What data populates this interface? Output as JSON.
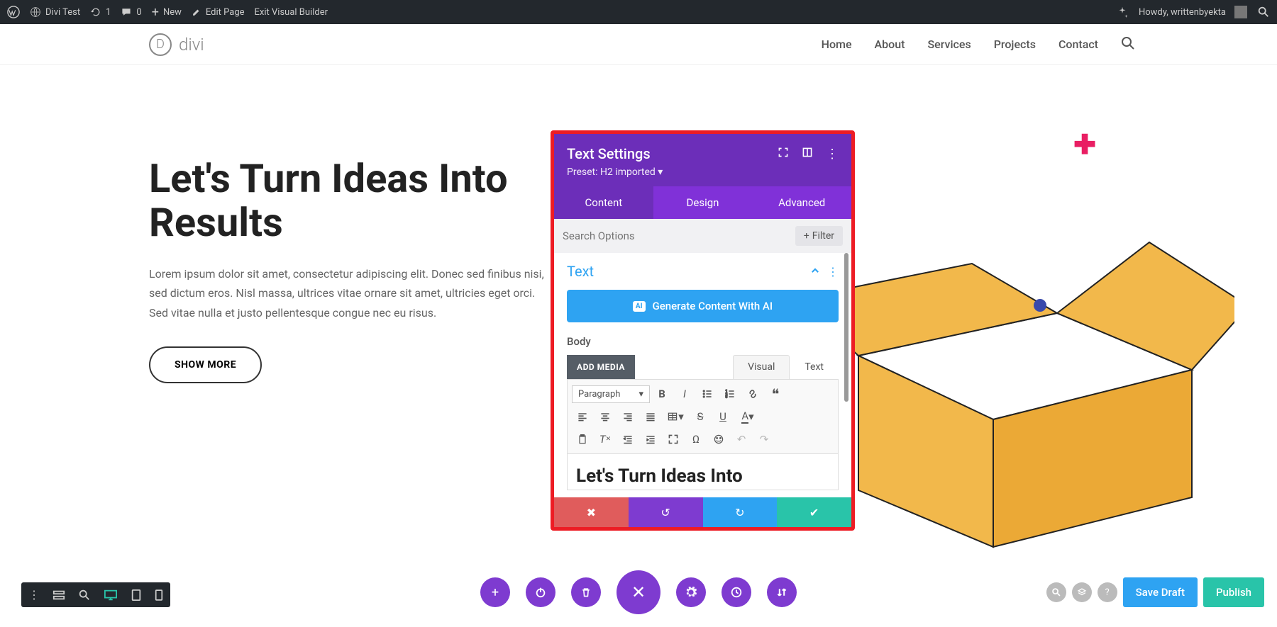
{
  "adminbar": {
    "site": "Divi Test",
    "refresh_count": "1",
    "comments": "0",
    "new": "New",
    "edit": "Edit Page",
    "exit": "Exit Visual Builder",
    "howdy": "Howdy, writtenbyekta"
  },
  "header": {
    "logo": "divi",
    "nav": [
      "Home",
      "About",
      "Services",
      "Projects",
      "Contact"
    ]
  },
  "hero": {
    "title": "Let's Turn Ideas Into Results",
    "body": "Lorem ipsum dolor sit amet, consectetur adipiscing elit. Donec sed finibus nisi, sed dictum eros. Nisl massa, ultrices vitae ornare sit amet, ultricies eget orci. Sed vitae nulla et justo pellentesque congue nec eu risus.",
    "cta": "SHOW MORE"
  },
  "panel": {
    "title": "Text Settings",
    "preset": "Preset: H2 imported ▾",
    "tabs": [
      "Content",
      "Design",
      "Advanced"
    ],
    "search_placeholder": "Search Options",
    "filter": "Filter",
    "section": "Text",
    "generate": "Generate Content With AI",
    "ai_badge": "AI",
    "body_label": "Body",
    "add_media": "ADD MEDIA",
    "editor_tabs": [
      "Visual",
      "Text"
    ],
    "format_select": "Paragraph",
    "editor_heading": "Let's Turn Ideas Into"
  },
  "bottom": {
    "save_draft": "Save Draft",
    "publish": "Publish"
  }
}
